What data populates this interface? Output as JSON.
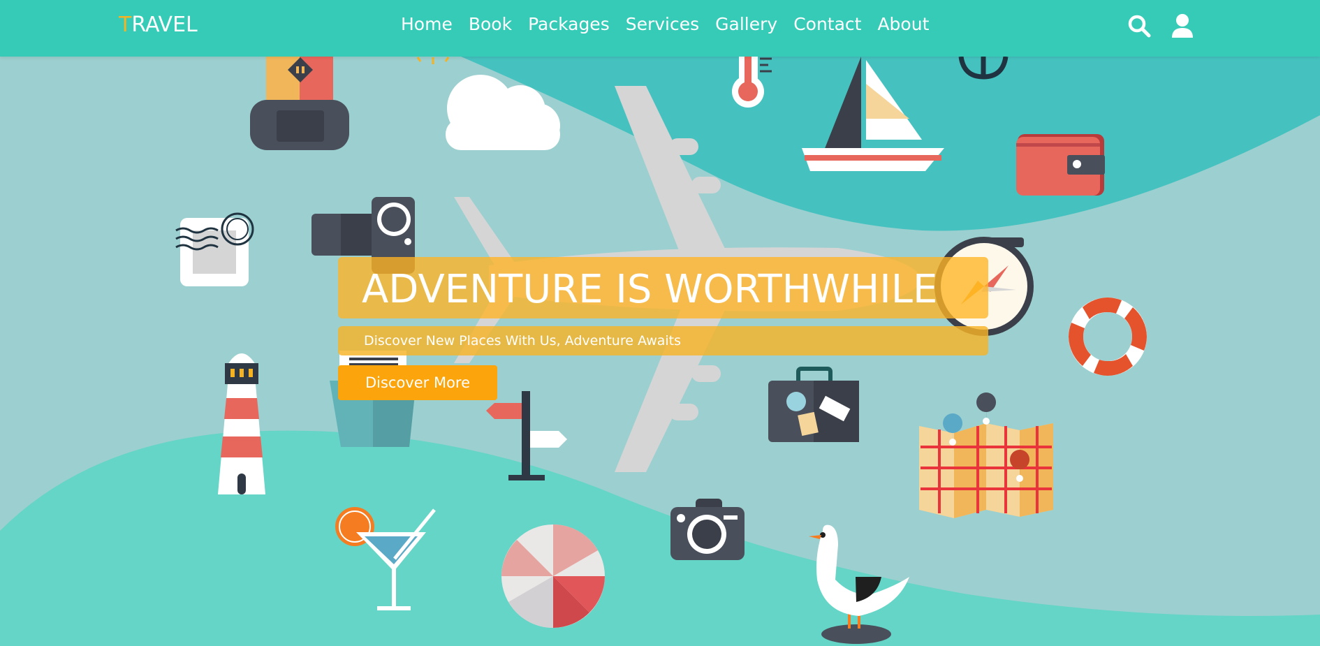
{
  "nav": {
    "logo_first": "T",
    "logo_rest": "RAVEL",
    "links": [
      "Home",
      "Book",
      "Packages",
      "Services",
      "Gallery",
      "Contact",
      "About"
    ],
    "icons": [
      "search-icon",
      "user-icon"
    ]
  },
  "hero": {
    "title": "ADVENTURE IS WORTHWHILE",
    "subtitle": "Discover New Places With Us, Adventure Awaits",
    "cta_label": "Discover More"
  },
  "colors": {
    "nav_bg": "#36cbb7",
    "accent": "#f5b324",
    "cta": "#fca40c",
    "background": "#9ccfcf"
  },
  "illustrations": [
    "backpack",
    "sun",
    "cloud",
    "thermometer",
    "sailboat",
    "anchor",
    "wallet",
    "postage-stamp",
    "video-camera",
    "airplane",
    "compass",
    "life-ring",
    "lighthouse",
    "ship",
    "signpost",
    "suitcase",
    "map",
    "cocktail",
    "beach-ball",
    "photo-camera",
    "seagull"
  ]
}
